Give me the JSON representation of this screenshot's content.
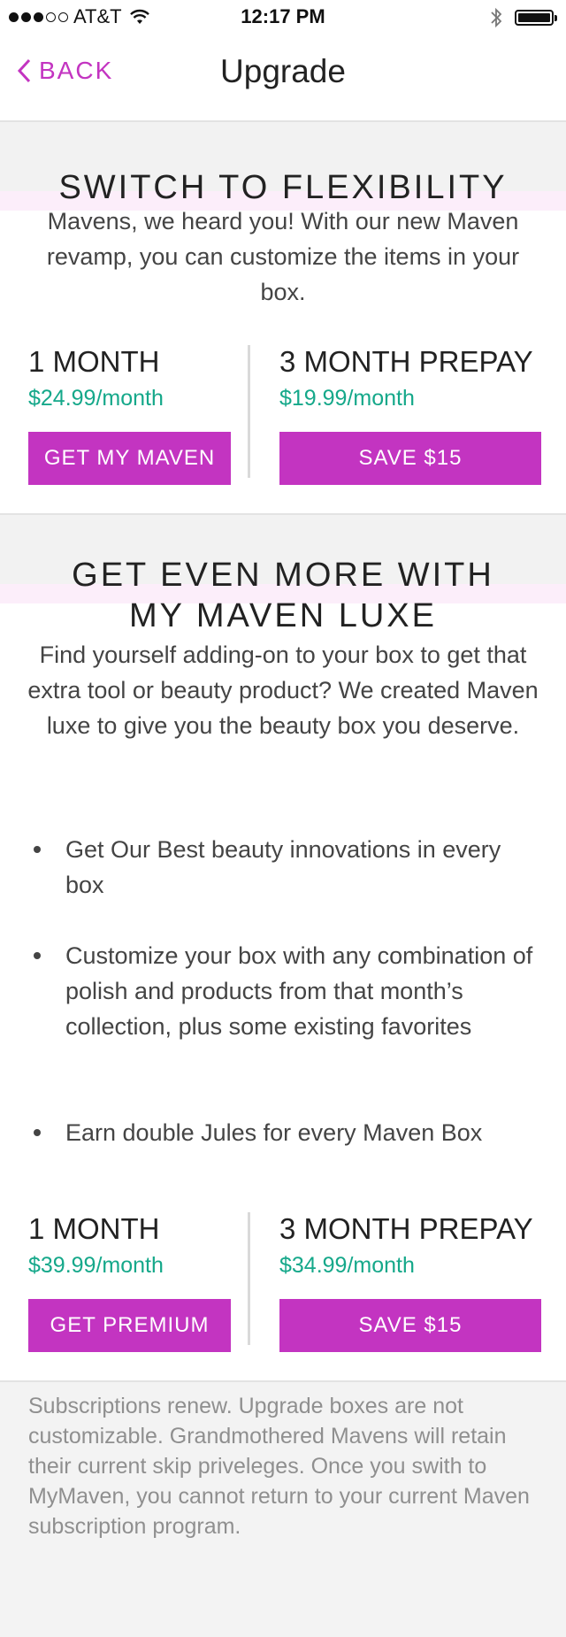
{
  "status_bar": {
    "carrier": "AT&T",
    "time": "12:17 PM",
    "signal_bars_filled": 3,
    "signal_bars_total": 5,
    "icons": [
      "wifi-icon",
      "bluetooth-icon",
      "battery-icon"
    ]
  },
  "nav": {
    "back_label": "BACK",
    "title": "Upgrade"
  },
  "colors": {
    "accent": "#c334c1",
    "price": "#15a88a",
    "background": "#f3f3f3",
    "highlight_band": "#fceefa"
  },
  "section1": {
    "heading": "SWITCH TO FLEXIBILITY",
    "description": "Mavens, we heard you! With our new Maven revamp, you can customize the items in your box.",
    "plans": [
      {
        "title": "1 MONTH",
        "price": "$24.99/month",
        "button": "GET MY MAVEN"
      },
      {
        "title": "3 MONTH PREPAY",
        "price": "$19.99/month",
        "button": "SAVE $15"
      }
    ]
  },
  "section2": {
    "heading_line1": "GET EVEN MORE WITH",
    "heading_line2": "MY MAVEN LUXE",
    "description": "Find yourself adding-on to your box to get that extra tool or beauty product? We created Maven luxe to give you the beauty box you deserve.",
    "bullets": [
      "Get Our Best beauty innovations in every box",
      "Customize your box with any combination of polish and products from that month’s collection, plus some existing favorites",
      "Earn double Jules for every Maven Box"
    ],
    "plans": [
      {
        "title": "1 MONTH",
        "price": "$39.99/month",
        "button": "GET PREMIUM"
      },
      {
        "title": "3 MONTH PREPAY",
        "price": "$34.99/month",
        "button": "SAVE $15"
      }
    ]
  },
  "footer_note": "Subscriptions renew. Upgrade boxes are not customizable. Grandmothered Mavens will retain their current skip priveleges. Once you swith to MyMaven, you cannot return to your current Maven subscription program."
}
